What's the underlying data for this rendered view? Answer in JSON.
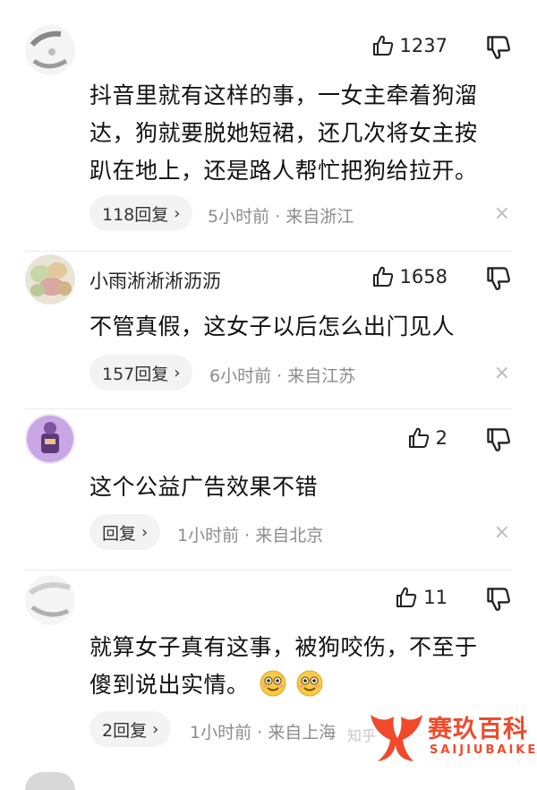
{
  "comments": [
    {
      "username": "",
      "likes": "1237",
      "text_lines": [
        "抖音里就有这样的事，一女主牵着狗溜",
        "达，狗就要脱她短裙，还几次将女主按",
        "趴在地上，还是路人帮忙把狗给拉开。"
      ],
      "reply_label": "118回复",
      "meta": "5小时前 · 来自浙江",
      "close": "×"
    },
    {
      "username": "小雨淅淅淅沥沥",
      "likes": "1658",
      "text_lines": [
        "不管真假，这女子以后怎么出门见人"
      ],
      "reply_label": "157回复",
      "meta": "6小时前 · 来自江苏",
      "close": "×"
    },
    {
      "username": "",
      "likes": "2",
      "text_lines": [
        "这个公益广告效果不错"
      ],
      "reply_label": "回复",
      "meta": "1小时前 · 来自北京",
      "close": "×"
    },
    {
      "username": "",
      "likes": "11",
      "text_lines": [
        "就算女子真有这事，被狗咬伤，不至于",
        "傻到说出实情。"
      ],
      "reply_label": "2回复",
      "meta": "1小时前 · 来自上海"
    }
  ],
  "icons": {
    "like": "thumbs-up-icon",
    "dislike": "thumbs-down-icon",
    "chevron": "chevron-right-icon",
    "emoji": "smiling-face-icon"
  },
  "reply_chevron": "›",
  "watermark": {
    "zhihu": "知乎",
    "brand_cn": "赛玖百科",
    "brand_en": "SAIJIUBAIKE"
  },
  "colors": {
    "meta_gray": "#8c8c8c",
    "pill_bg": "#f3f3f3",
    "brand_red": "#f04a2b"
  }
}
